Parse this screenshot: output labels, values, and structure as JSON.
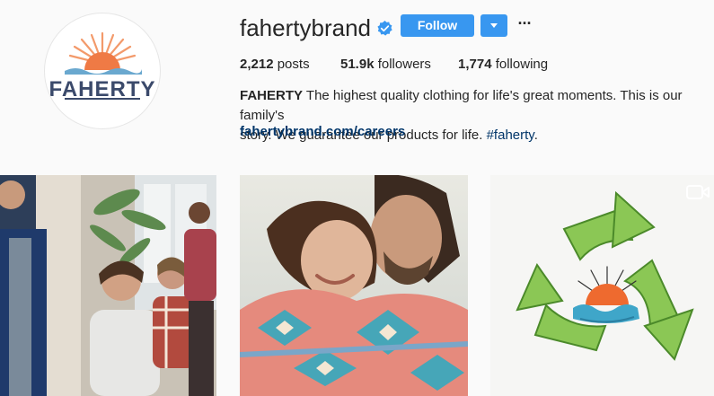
{
  "profile": {
    "username": "fahertybrand",
    "verified_icon": "verified-badge-icon",
    "logo_text": "FAHERTY",
    "follow_label": "Follow",
    "dropdown_icon": "chevron-down-icon",
    "more_label": "···",
    "accent_color": "#3897f0"
  },
  "stats": {
    "posts_count": "2,212",
    "posts_label": "posts",
    "followers_count": "51.9k",
    "followers_label": "followers",
    "following_count": "1,774",
    "following_label": "following"
  },
  "bio": {
    "name": "FAHERTY",
    "text_line1": "The highest quality clothing for life's great moments. This is our family's",
    "text_line2": "story. We guarantee our products for life.",
    "hashtag": "#faherty",
    "period": ".",
    "website": "fahertybrand.com/careers"
  },
  "posts": [
    {
      "kind": "photo",
      "subject": "group-of-people-photo"
    },
    {
      "kind": "photo",
      "subject": "couple-in-blanket-photo"
    },
    {
      "kind": "video",
      "subject": "recycle-sun-illustration",
      "icon": "video-camera-icon"
    }
  ]
}
